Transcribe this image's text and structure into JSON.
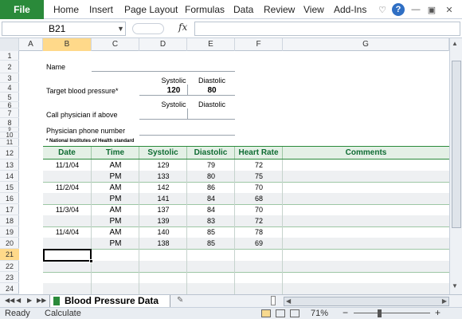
{
  "ribbon": {
    "file": "File",
    "tabs": [
      "Home",
      "Insert",
      "Page Layout",
      "Formulas",
      "Data",
      "Review",
      "View",
      "Add-Ins"
    ],
    "accent": "#2a8a3a"
  },
  "formula_bar": {
    "name_box": "B21",
    "fx": "fx",
    "value": ""
  },
  "columns": [
    "A",
    "B",
    "C",
    "D",
    "E",
    "F",
    "G"
  ],
  "rows": [
    "1",
    "2",
    "3",
    "4",
    "5",
    "6",
    "7",
    "8",
    "9",
    "10",
    "11",
    "12",
    "13",
    "14",
    "15",
    "16",
    "17",
    "18",
    "19",
    "20",
    "21",
    "22",
    "23",
    "24"
  ],
  "form": {
    "name_label": "Name",
    "systolic": "Systolic",
    "diastolic": "Diastolic",
    "target_label": "Target blood pressure*",
    "target_systolic": "120",
    "target_diastolic": "80",
    "call_label": "Call physician if above",
    "phone_label": "Physician phone number",
    "footnote": "* National Institutes of Health standard"
  },
  "table": {
    "headers": [
      "Date",
      "Time",
      "Systolic",
      "Diastolic",
      "Heart Rate",
      "Comments"
    ],
    "rows": [
      [
        "11/1/04",
        "AM",
        "129",
        "79",
        "72",
        ""
      ],
      [
        "",
        "PM",
        "133",
        "80",
        "75",
        ""
      ],
      [
        "11/2/04",
        "AM",
        "142",
        "86",
        "70",
        ""
      ],
      [
        "",
        "PM",
        "141",
        "84",
        "68",
        ""
      ],
      [
        "11/3/04",
        "AM",
        "137",
        "84",
        "70",
        ""
      ],
      [
        "",
        "PM",
        "139",
        "83",
        "72",
        ""
      ],
      [
        "11/4/04",
        "AM",
        "140",
        "85",
        "78",
        ""
      ],
      [
        "",
        "PM",
        "138",
        "85",
        "69",
        ""
      ]
    ]
  },
  "sheet_tab": "Blood Pressure Data",
  "status": {
    "ready": "Ready",
    "calculate": "Calculate",
    "zoom": "71%"
  }
}
